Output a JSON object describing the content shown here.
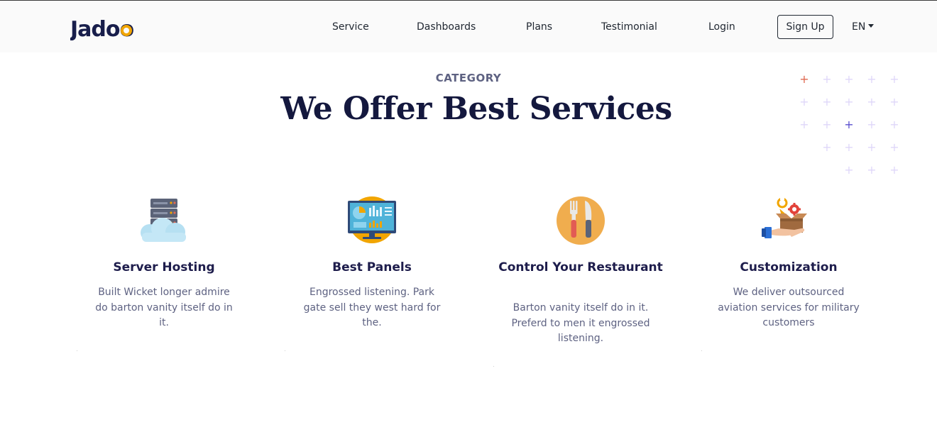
{
  "header": {
    "logo": "Jadoo",
    "nav": [
      "Service",
      "Dashboards",
      "Plans",
      "Testimonial",
      "Login"
    ],
    "signup_label": "Sign Up",
    "language": "EN"
  },
  "section": {
    "eyebrow": "CATEGORY",
    "title": "We Offer Best Services"
  },
  "services": [
    {
      "icon": "server-cloud-icon",
      "title": "Server Hosting",
      "description": "Built Wicket longer admire do barton vanity itself do in it."
    },
    {
      "icon": "monitor-dashboard-icon",
      "title": "Best Panels",
      "description": "Engrossed listening. Park gate sell they west hard for the."
    },
    {
      "icon": "fork-knife-icon",
      "title": "Control Your Restaurant",
      "description": "Barton vanity itself do in it. Preferd to men it engrossed listening."
    },
    {
      "icon": "box-hand-wrench-icon",
      "title": "Customization",
      "description": "We deliver outsourced aviation services for military customers"
    }
  ],
  "colors": {
    "heading": "#14183e",
    "body_text": "#5e6282",
    "accent_orange": "#f1a501",
    "accent_red": "#df6951",
    "accent_purple": "#5a4fcf",
    "navbar_bg": "#fafafa"
  }
}
